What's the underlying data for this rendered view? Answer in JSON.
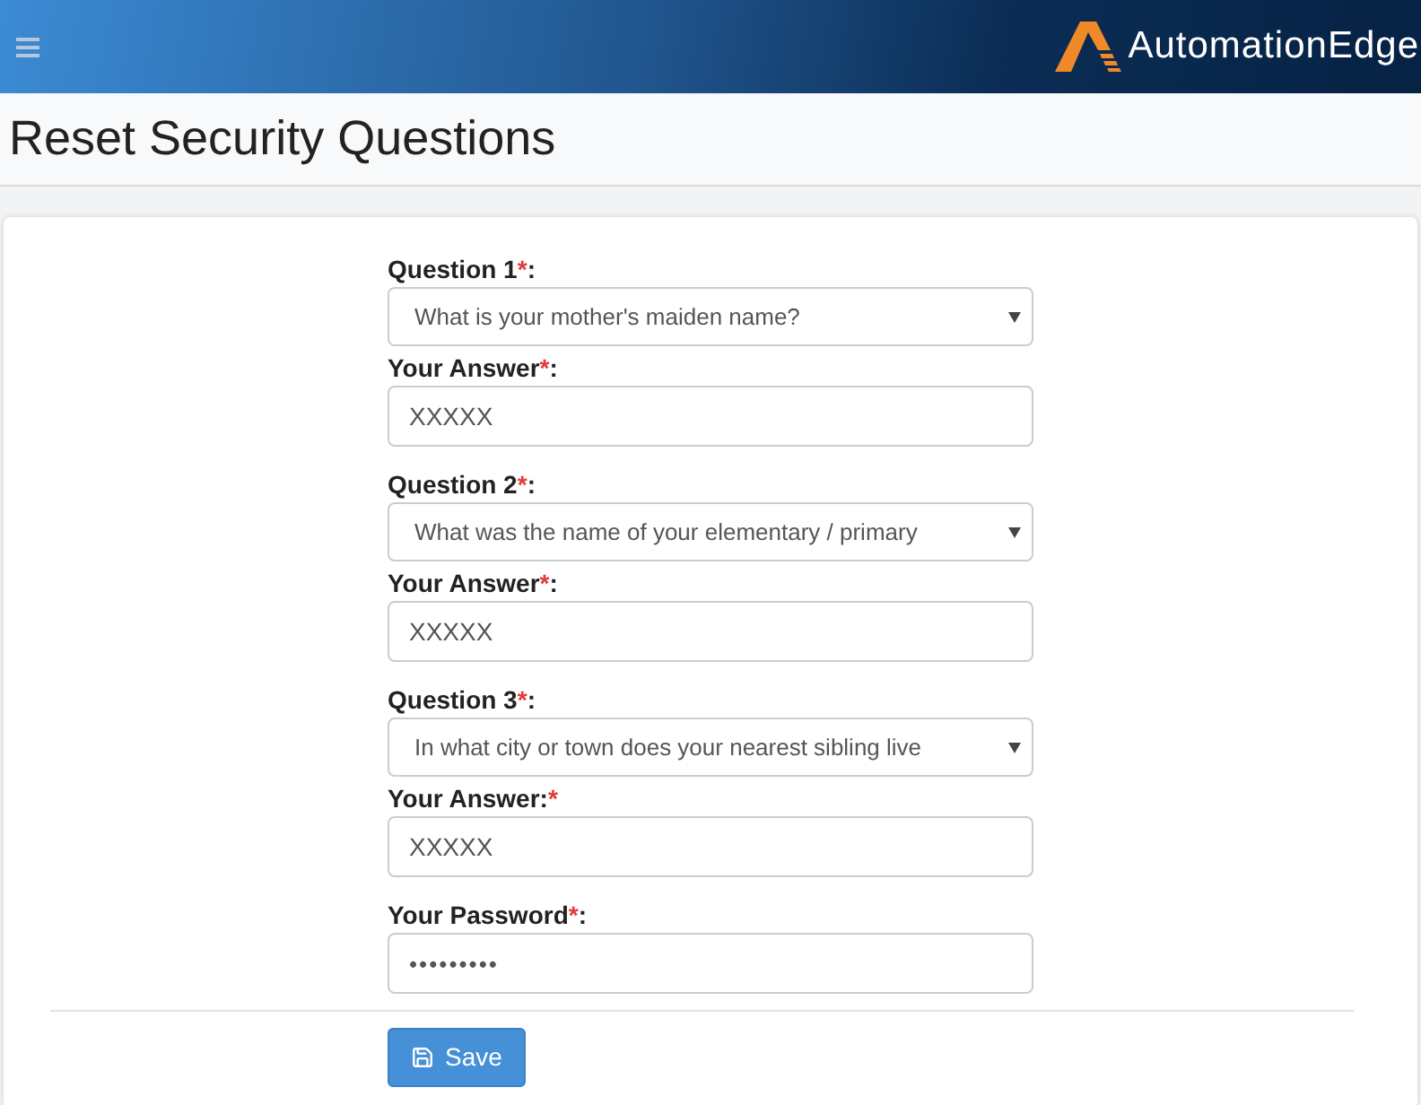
{
  "header": {
    "logo_text": "AutomationEdge"
  },
  "page_title": "Reset Security Questions",
  "form": {
    "fields": [
      {
        "kind": "select",
        "label": [
          {
            "kind": "text",
            "text": "Question 1"
          },
          {
            "kind": "required",
            "text": "*"
          },
          {
            "kind": "text",
            "text": ":"
          }
        ],
        "value": "What is your mother's maiden name?"
      },
      {
        "kind": "input",
        "label": [
          {
            "kind": "text",
            "text": "Your Answer"
          },
          {
            "kind": "required",
            "text": "*"
          },
          {
            "kind": "text",
            "text": ":"
          }
        ],
        "value": "XXXXX"
      },
      {
        "kind": "select",
        "label": [
          {
            "kind": "text",
            "text": "Question 2"
          },
          {
            "kind": "required",
            "text": "*"
          },
          {
            "kind": "text",
            "text": ":"
          }
        ],
        "value": "What was the name of your elementary / primary"
      },
      {
        "kind": "input",
        "label": [
          {
            "kind": "text",
            "text": "Your Answer"
          },
          {
            "kind": "required",
            "text": "*"
          },
          {
            "kind": "text",
            "text": ":"
          }
        ],
        "value": "XXXXX"
      },
      {
        "kind": "select",
        "label": [
          {
            "kind": "text",
            "text": "Question 3"
          },
          {
            "kind": "required",
            "text": "*"
          },
          {
            "kind": "text",
            "text": ":"
          }
        ],
        "value": "In what city or town does your nearest sibling live"
      },
      {
        "kind": "input",
        "label": [
          {
            "kind": "text",
            "text": "Your Answer:"
          },
          {
            "kind": "required",
            "text": "*"
          }
        ],
        "value": "XXXXX"
      },
      {
        "kind": "password",
        "label": [
          {
            "kind": "text",
            "text": "Your Password"
          },
          {
            "kind": "required",
            "text": "*"
          },
          {
            "kind": "text",
            "text": ":"
          }
        ],
        "value": "•••••••••"
      }
    ],
    "buttons": [
      {
        "kind": "save",
        "label": "Save"
      }
    ]
  }
}
